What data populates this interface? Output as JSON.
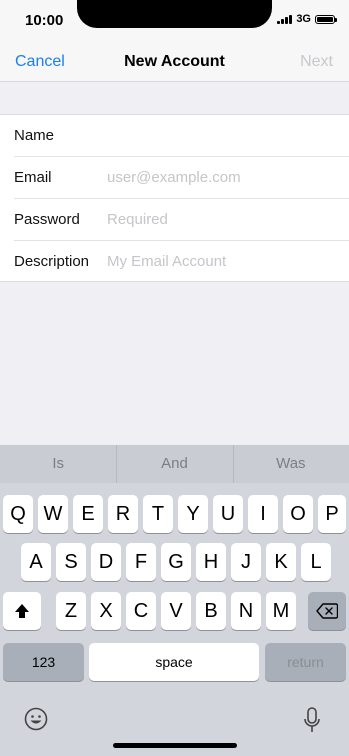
{
  "status": {
    "time": "10:00",
    "network": "3G"
  },
  "nav": {
    "cancel": "Cancel",
    "title": "New Account",
    "next": "Next"
  },
  "form": {
    "rows": [
      {
        "label": "Name",
        "placeholder": ""
      },
      {
        "label": "Email",
        "placeholder": "user@example.com"
      },
      {
        "label": "Password",
        "placeholder": "Required"
      },
      {
        "label": "Description",
        "placeholder": "My Email Account"
      }
    ]
  },
  "keyboard": {
    "suggestions": [
      "Is",
      "And",
      "Was"
    ],
    "row1": [
      "Q",
      "W",
      "E",
      "R",
      "T",
      "Y",
      "U",
      "I",
      "O",
      "P"
    ],
    "row2": [
      "A",
      "S",
      "D",
      "F",
      "G",
      "H",
      "J",
      "K",
      "L"
    ],
    "row3": [
      "Z",
      "X",
      "C",
      "V",
      "B",
      "N",
      "M"
    ],
    "numbers": "123",
    "space": "space",
    "return": "return",
    "shift_icon": "shift-icon",
    "delete_icon": "backspace-icon",
    "emoji_icon": "emoji-icon",
    "dictation_icon": "microphone-icon"
  }
}
